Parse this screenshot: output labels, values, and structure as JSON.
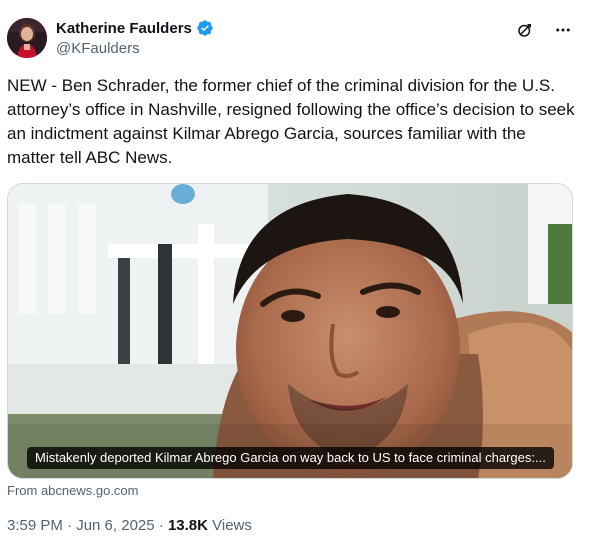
{
  "author": {
    "display_name": "Katherine Faulders",
    "handle": "@KFaulders",
    "verified": true
  },
  "tweet": {
    "text": "NEW - Ben Schrader, the former chief of the criminal division for the U.S. attorney’s office in Nashville, resigned following the office’s decision to seek an indictment against Kilmar Abrego Garcia, sources familiar with the matter tell ABC News."
  },
  "card": {
    "caption": "Mistakenly deported Kilmar Abrego Garcia on way back to US to face criminal charges:...",
    "source": "From abcnews.go.com"
  },
  "meta": {
    "timestamp": "3:59 PM · Jun 6, 2025",
    "separator": " · ",
    "views_count": "13.8K",
    "views_label": " Views"
  },
  "icons": {
    "verified": "verified-badge-icon",
    "grok": "grok-icon",
    "more": "more-icon"
  },
  "colors": {
    "text_primary": "#0f1419",
    "text_secondary": "#536471",
    "verified_blue": "#1d9bf0",
    "border": "#cfd9de"
  }
}
